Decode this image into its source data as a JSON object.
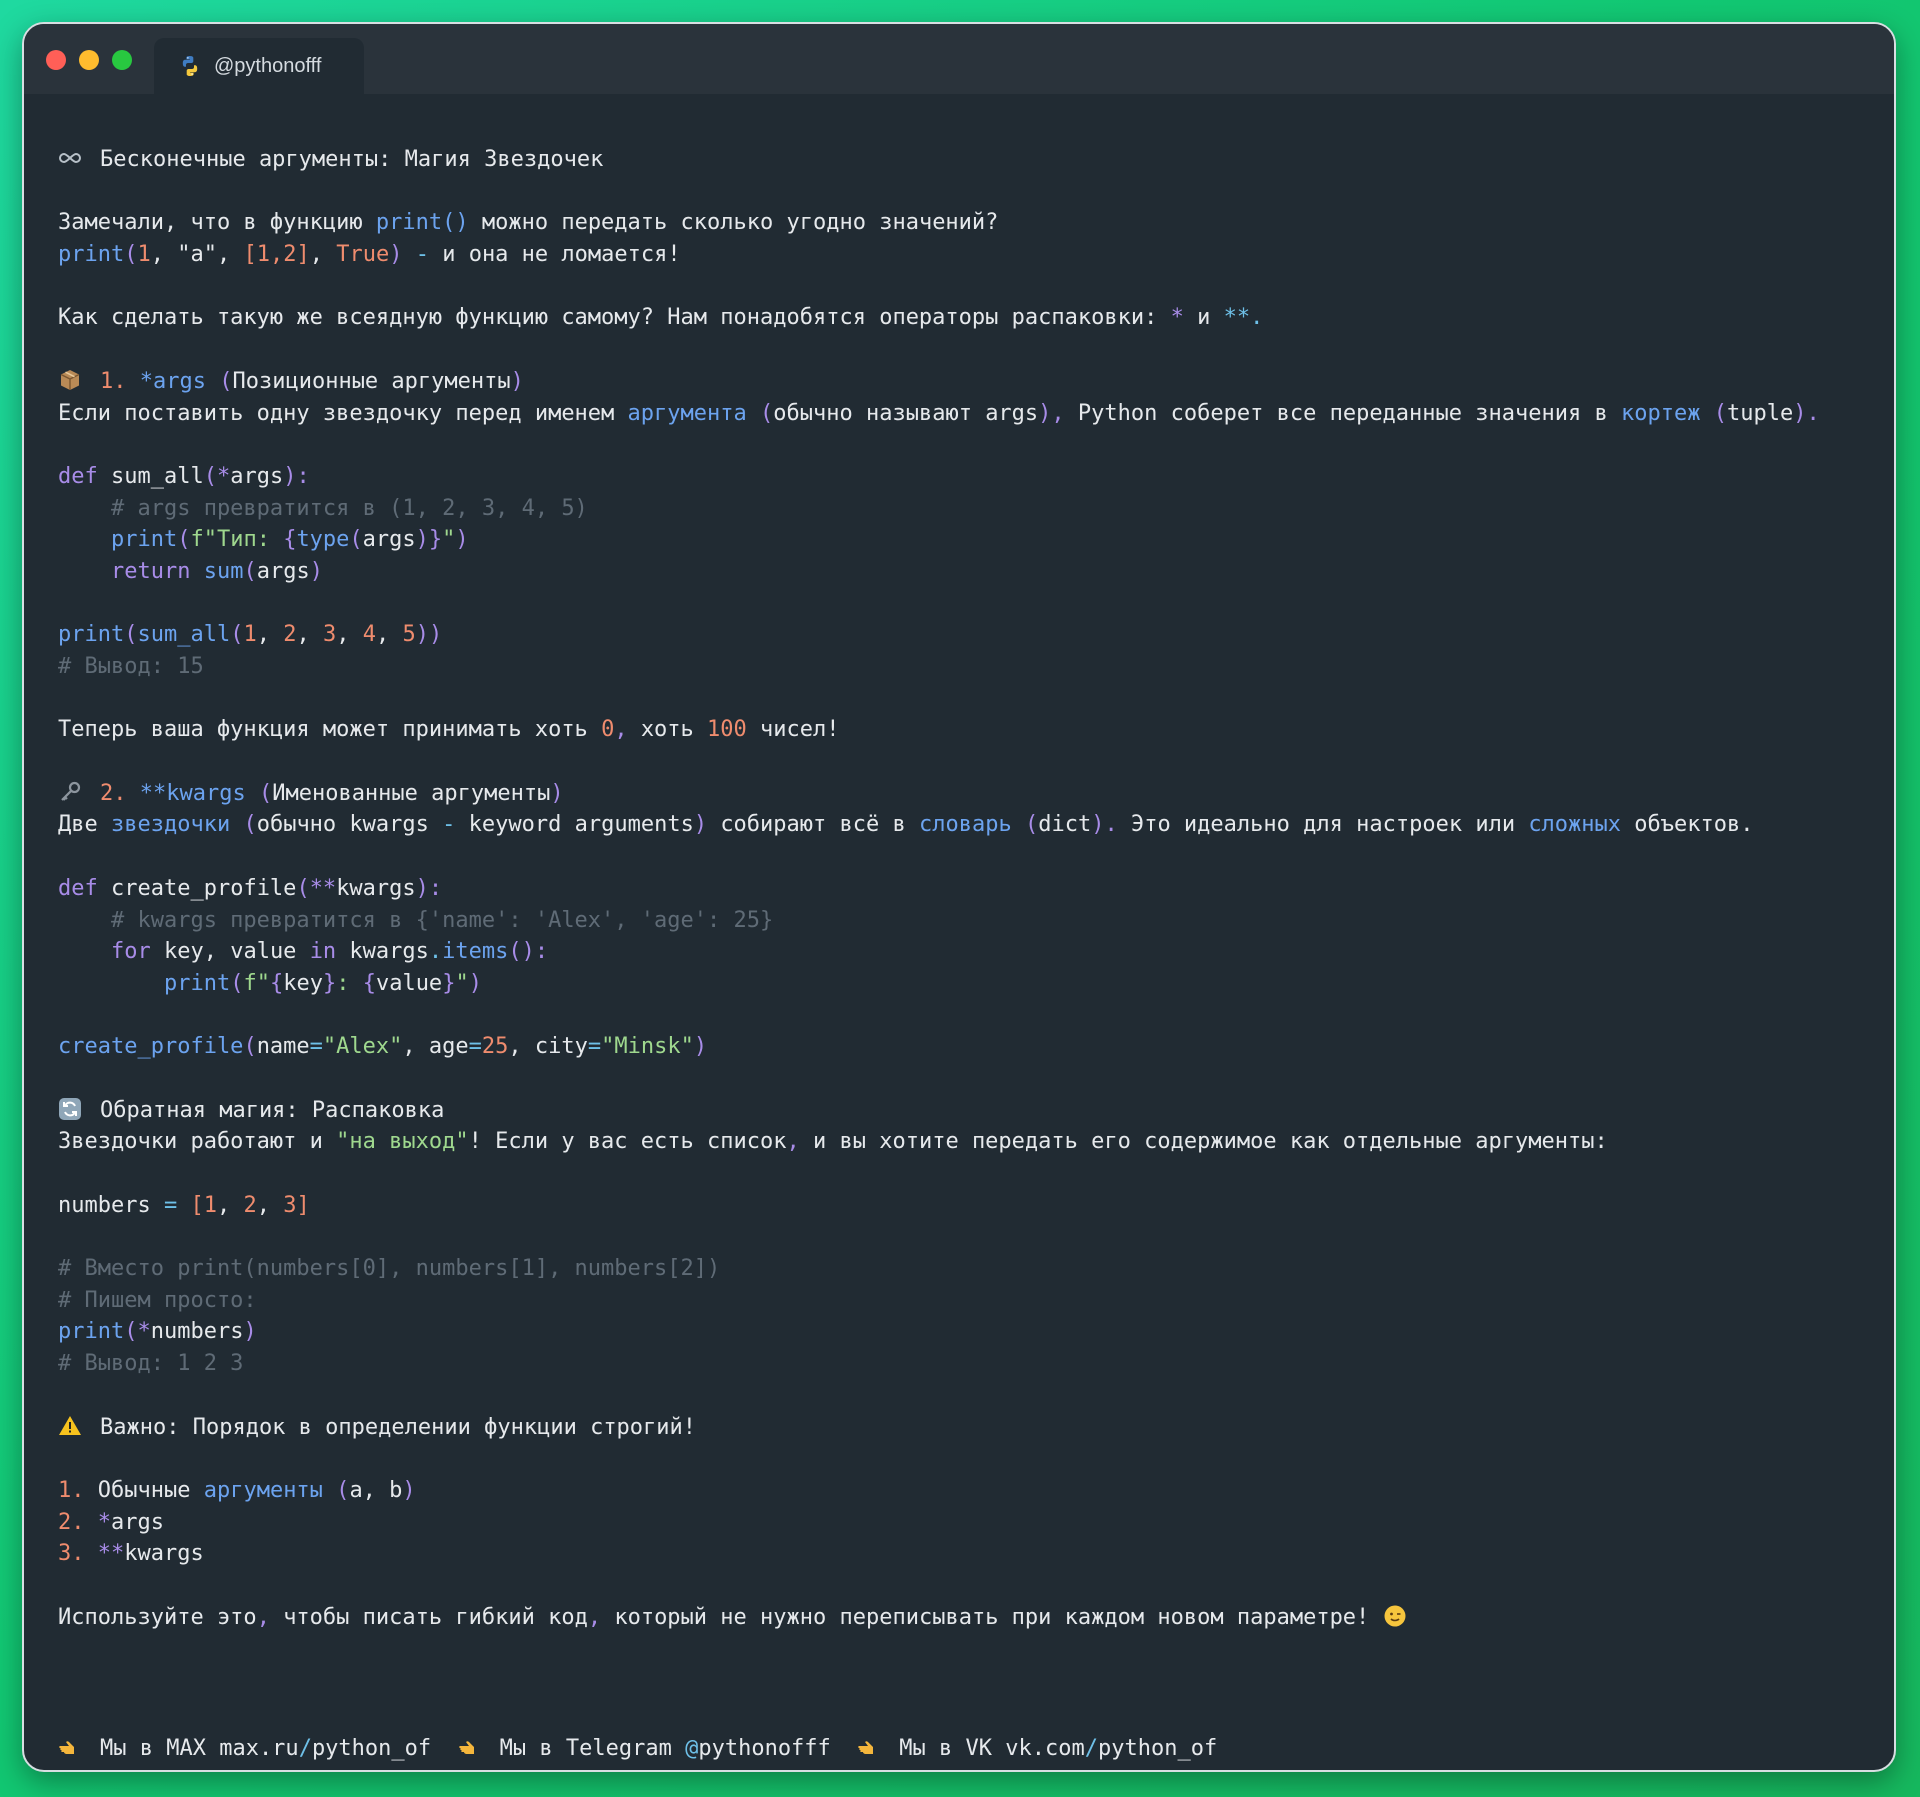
{
  "window": {
    "tab_title": "@pythonofff"
  },
  "post": {
    "title": "Бесконечные аргументы: Магия Звездочек",
    "intro": {
      "q_a": "Замечали, что в функцию ",
      "q_b": "print()",
      "q_c": " можно передать сколько угодно значений?",
      "ex_print": "print",
      "ex_p1": "(",
      "ex_1": "1",
      "ex_c1": ", ",
      "ex_a": "\"a\"",
      "ex_c2": ", ",
      "ex_list": "[1,2]",
      "ex_c3": ", ",
      "ex_true": "True",
      "ex_p2": ")",
      "ex_dash": " - ",
      "ex_rest": "и она не ломается!"
    },
    "ask": {
      "a": "Как сделать такую же всеядную функцию самому? Нам понадобятся операторы распаковки: ",
      "star": "*",
      "and": " и ",
      "dstar": "**",
      "dot": "."
    },
    "s1": {
      "num": "1. ",
      "name": "*args",
      "paren": " (",
      "desc": "Позиционные аргументы",
      "close": ")",
      "t_a": "Если поставить одну звездочку перед именем ",
      "t_link1": "аргумента",
      "t_b": " (",
      "t_c": "обычно называют args",
      "t_d": "), ",
      "t_e": "Python соберет все переданные значения в ",
      "t_link2": "кортеж",
      "t_f": " (",
      "t_g": "tuple",
      "t_h": ")."
    },
    "code1": {
      "l1_def": "def",
      "l1_name": " sum_all",
      "l1_p": "(",
      "l1_star": "*",
      "l1_arg": "args",
      "l1_end": "):",
      "l2": "    # args превратится в (1, 2, 3, 4, 5)",
      "l3_print": "print",
      "l3_p": "(",
      "l3_f": "f\"Тип: ",
      "l3_b1": "{",
      "l3_type": "type",
      "l3_p2": "(",
      "l3_args": "args",
      "l3_p3": ")",
      "l3_b2": "}",
      "l3_q": "\"",
      "l3_end": ")",
      "l4_ret": "return",
      "l4_sum": " sum",
      "l4_p": "(",
      "l4_args": "args",
      "l4_end": ")",
      "l5_print": "print",
      "l5_p": "(",
      "l5_fn": "sum_all",
      "l5_p2": "(",
      "l5_n1": "1",
      "l5_c1": ", ",
      "l5_n2": "2",
      "l5_c2": ", ",
      "l5_n3": "3",
      "l5_c3": ", ",
      "l5_n4": "4",
      "l5_c4": ", ",
      "l5_n5": "5",
      "l5_end": "))",
      "l6": "# Вывод: 15"
    },
    "s1_after": {
      "a": "Теперь ваша функция может принимать хоть ",
      "n0": "0",
      "b": ", ",
      "c": "хоть ",
      "n100": "100",
      "d": " чисел!"
    },
    "s2": {
      "num": "2. ",
      "name": "**kwargs",
      "paren": " (",
      "desc": "Именованные аргументы",
      "close": ")",
      "t_a": "Две ",
      "t_link1": "звездочки",
      "t_b": " (",
      "t_c": "обычно kwargs",
      "t_dash": " - ",
      "t_d": "keyword arguments",
      "t_e": ") ",
      "t_f": "собирают всё в ",
      "t_link2": "словарь",
      "t_g": " (",
      "t_h": "dict",
      "t_i": "). ",
      "t_j": "Это идеально для настроек или ",
      "t_link3": "сложных",
      "t_k": " объектов."
    },
    "code2": {
      "l1_def": "def",
      "l1_name": " create_profile",
      "l1_p": "(",
      "l1_star": "**",
      "l1_arg": "kwargs",
      "l1_end": "):",
      "l2": "    # kwargs превратится в {'name': 'Alex', 'age': 25}",
      "l3_for": "for",
      "l3_a": " key, value ",
      "l3_in": "in",
      "l3_b": " kwargs",
      "l3_dot": ".",
      "l3_items": "items",
      "l3_end": "():",
      "l4_print": "print",
      "l4_p": "(",
      "l4_f": "f\"",
      "l4_b1": "{",
      "l4_key": "key",
      "l4_b2": "}",
      "l4_colon": ": ",
      "l4_b3": "{",
      "l4_val": "value",
      "l4_b4": "}",
      "l4_q": "\"",
      "l4_end": ")",
      "l5_fn": "create_profile",
      "l5_p": "(",
      "l5_name": "name",
      "l5_eq1": "=",
      "l5_alex": "\"Alex\"",
      "l5_c1": ", ",
      "l5_age": "age",
      "l5_eq2": "=",
      "l5_25": "25",
      "l5_c2": ", ",
      "l5_city": "city",
      "l5_eq3": "=",
      "l5_minsk": "\"Minsk\"",
      "l5_end": ")"
    },
    "s3": {
      "title": "Обратная магия: Распаковка",
      "t_a": "Звездочки работают и ",
      "t_q": "\"на выход\"",
      "t_b": "! Если у вас есть список",
      "t_c": ", ",
      "t_d": "и вы хотите передать его содержимое как отдельные аргументы:"
    },
    "code3": {
      "l1_a": "numbers ",
      "l1_eq": "=",
      "l1_sp": " ",
      "l1_b1": "[",
      "l1_1": "1",
      "l1_c1": ", ",
      "l1_2": "2",
      "l1_c2": ", ",
      "l1_3": "3",
      "l1_b2": "]",
      "l2": "# Вместо print(numbers[0], numbers[1], numbers[2])",
      "l3": "# Пишем просто:",
      "l4_print": "print",
      "l4_p": "(",
      "l4_star": "*",
      "l4_arg": "numbers",
      "l4_end": ")",
      "l5": "# Вывод: 1 2 3"
    },
    "warn": {
      "text": "Важно: Порядок в определении функции строгий!"
    },
    "order": {
      "n1": "1.",
      "i1_a": " Обычные ",
      "i1_link": "аргументы",
      "i1_b": " (",
      "i1_c": "a, b",
      "i1_d": ")",
      "n2": "2.",
      "i2_star": " *",
      "i2_name": "args",
      "n3": "3.",
      "i3_star": " **",
      "i3_name": "kwargs"
    },
    "outro": {
      "a": "Используйте это",
      "c1": ", ",
      "b": "чтобы писать гибкий код",
      "c2": ", ",
      "c": "который не нужно переписывать при каждом новом параметре! "
    }
  },
  "footer": {
    "max_a": "Мы в MAX max.ru",
    "max_sl": "/",
    "max_b": "python_of",
    "tg_a": "Мы в Telegram ",
    "tg_at": "@",
    "tg_b": "pythonofff",
    "vk_a": "Мы в VK vk.com",
    "vk_sl": "/",
    "vk_b": "python_of"
  },
  "icons": {
    "title": "infinity-icon",
    "s1": "package-icon",
    "s2": "key-icon",
    "s3": "refresh-icon",
    "warn": "warning-icon",
    "outro": "wink-emoji-icon",
    "footer": "pointing-hand-icon"
  },
  "colors": {
    "keyword": "#a88ce8",
    "function": "#6ca3ef",
    "string": "#9fd88e",
    "number": "#ef8c6e",
    "comment": "#5f6b76",
    "background": "#212b33"
  }
}
